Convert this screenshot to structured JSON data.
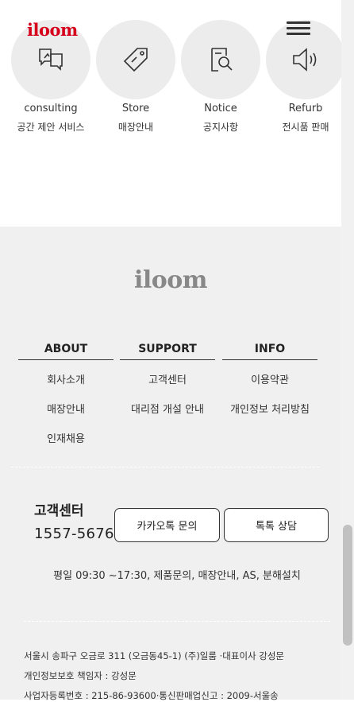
{
  "header": {
    "logo": "iloom",
    "menu_icon": "hamburger-menu-icon"
  },
  "services": [
    {
      "title": "consulting",
      "subtitle": "공간 제안 서비스",
      "icon": "consulting-icon"
    },
    {
      "title": "Store",
      "subtitle": "매장안내",
      "icon": "price-tag-icon"
    },
    {
      "title": "Notice",
      "subtitle": "공지사항",
      "icon": "notice-search-icon"
    },
    {
      "title": "Refurb",
      "subtitle": "전시품 판매",
      "icon": "speaker-icon"
    }
  ],
  "footer": {
    "logo": "iloom",
    "columns": [
      {
        "title": "ABOUT",
        "links": [
          "회사소개",
          "매장안내",
          "인재채용"
        ]
      },
      {
        "title": "SUPPORT",
        "links": [
          "고객센터",
          "대리점 개설 안내"
        ]
      },
      {
        "title": "INFO",
        "links": [
          "이용약관",
          "개인정보 처리방침"
        ]
      }
    ],
    "customer_center": {
      "title": "고객센터",
      "phone": "1557-5676",
      "kakao_button": "카카오톡 문의",
      "talk_button": "톡톡 상담",
      "hours": "평일 09:30 ~17:30, 제품문의, 매장안내, AS, 분해설치"
    },
    "company_info": [
      "서울시 송파구 오금로 311 (오금동45-1) (주)일룸 ·대표이사 강성문",
      "개인정보보호 책임자 : 강성문",
      "사업자등록번호 : 215-86-93600·통신판매업신고 : 2009-서울송"
    ]
  },
  "colors": {
    "brand_red": "#d6001c",
    "footer_bg": "#f0f0f0",
    "circle_bg": "#ececec"
  }
}
